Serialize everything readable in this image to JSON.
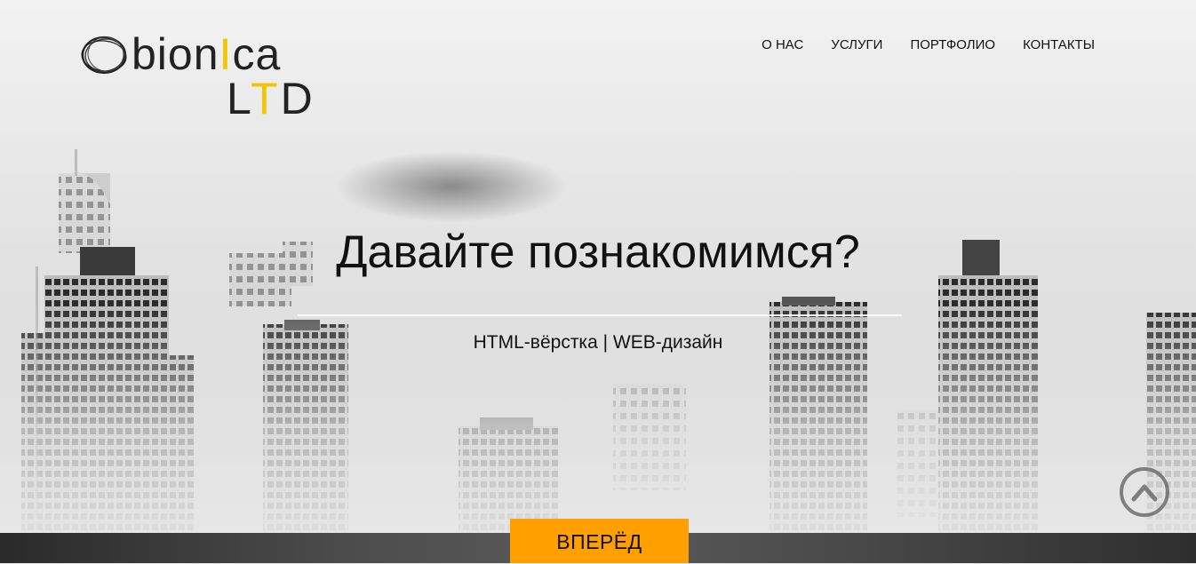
{
  "logo": {
    "first_o": "O",
    "line1_a": "bion",
    "line1_i": "I",
    "line1_b": "ca",
    "line2_a": "L",
    "line2_t": "T",
    "line2_b": "D"
  },
  "nav": {
    "items": [
      {
        "label": "О НАС"
      },
      {
        "label": "УСЛУГИ"
      },
      {
        "label": "ПОРТФОЛИО"
      },
      {
        "label": "КОНТАКТЫ"
      }
    ]
  },
  "hero": {
    "headline": "Давайте познакомимся?",
    "tagline": "HTML-вёрстка | WEB-дизайн",
    "cta_label": "ВПЕРЁД"
  },
  "icons": {
    "scroll_up": "chevron-up-icon"
  },
  "colors": {
    "accent_yellow": "#f5c400",
    "cta_orange": "#ff9f00"
  }
}
